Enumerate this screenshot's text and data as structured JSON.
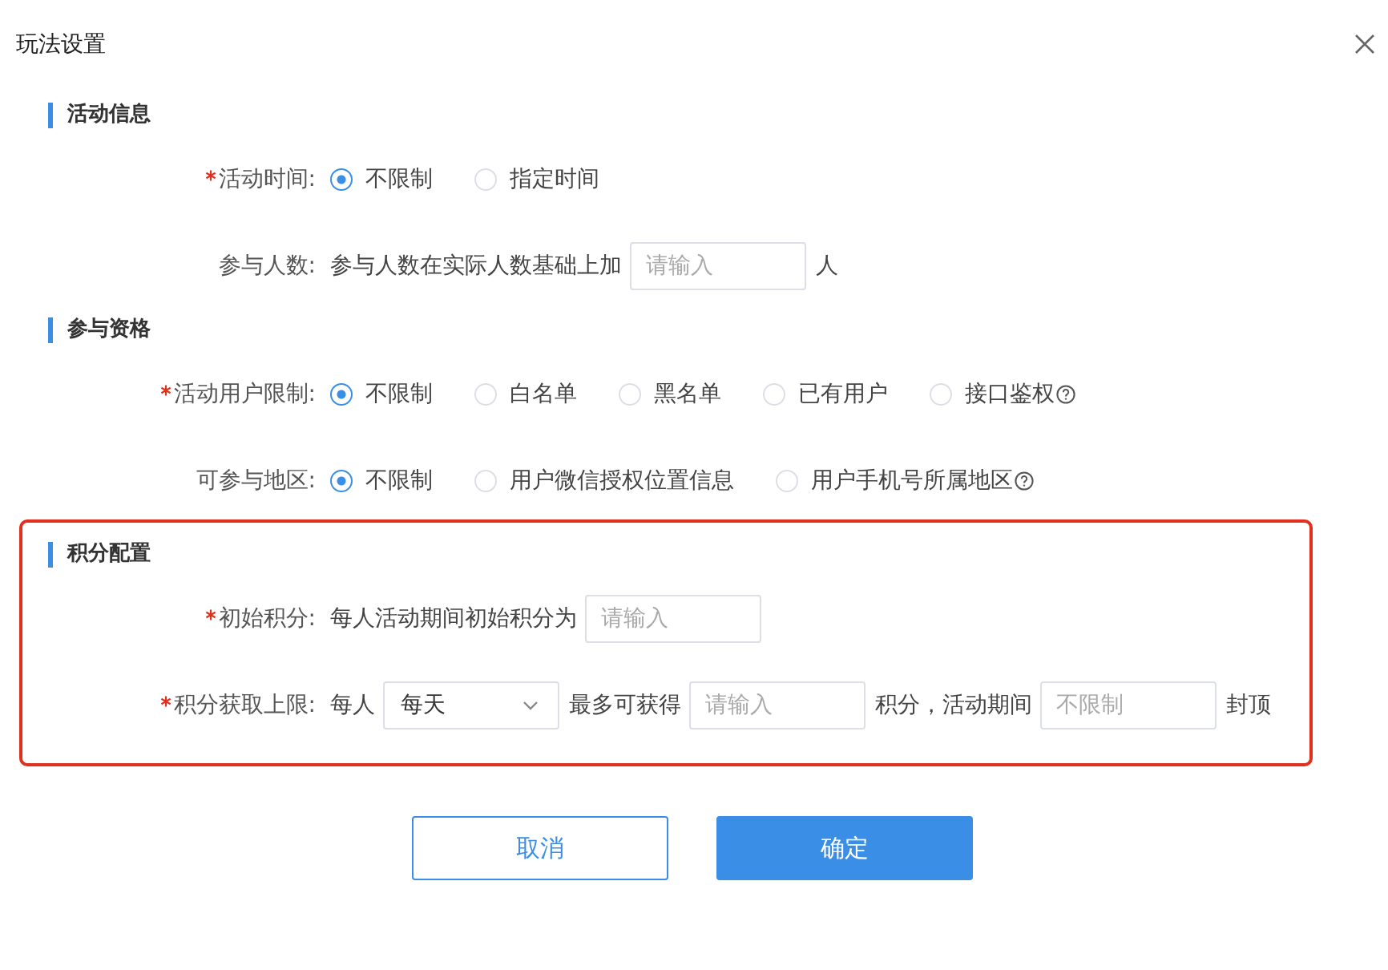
{
  "dialog": {
    "title": "玩法设置"
  },
  "sections": [
    {
      "title": "活动信息",
      "highlighted": false,
      "rows": [
        {
          "label": "活动时间:",
          "required": true,
          "items": [
            {
              "kind": "radio",
              "label": "不限制",
              "selected": true
            },
            {
              "kind": "radio",
              "label": "指定时间",
              "selected": false
            }
          ]
        },
        {
          "label": "参与人数:",
          "required": false,
          "items": [
            {
              "kind": "text",
              "text": "参与人数在实际人数基础上加"
            },
            {
              "kind": "input",
              "placeholder": "请输入"
            },
            {
              "kind": "text",
              "text": "人"
            }
          ]
        }
      ]
    },
    {
      "title": "参与资格",
      "highlighted": false,
      "rows": [
        {
          "label": "活动用户限制:",
          "required": true,
          "items": [
            {
              "kind": "radio",
              "label": "不限制",
              "selected": true
            },
            {
              "kind": "radio",
              "label": "白名单",
              "selected": false
            },
            {
              "kind": "radio",
              "label": "黑名单",
              "selected": false
            },
            {
              "kind": "radio",
              "label": "已有用户",
              "selected": false
            },
            {
              "kind": "radio",
              "label": "接口鉴权",
              "selected": false
            },
            {
              "kind": "help"
            }
          ]
        },
        {
          "label": "可参与地区:",
          "required": false,
          "items": [
            {
              "kind": "radio",
              "label": "不限制",
              "selected": true
            },
            {
              "kind": "radio",
              "label": "用户微信授权位置信息",
              "selected": false
            },
            {
              "kind": "radio",
              "label": "用户手机号所属地区",
              "selected": false
            },
            {
              "kind": "help"
            }
          ]
        }
      ]
    },
    {
      "title": "积分配置",
      "highlighted": true,
      "rows": [
        {
          "label": "初始积分:",
          "required": true,
          "items": [
            {
              "kind": "text",
              "text": "每人活动期间初始积分为"
            },
            {
              "kind": "input",
              "placeholder": "请输入"
            }
          ]
        },
        {
          "label": "积分获取上限:",
          "required": true,
          "items": [
            {
              "kind": "text",
              "text": "每人"
            },
            {
              "kind": "select",
              "value": "每天"
            },
            {
              "kind": "text",
              "text": "最多可获得"
            },
            {
              "kind": "input",
              "placeholder": "请输入"
            },
            {
              "kind": "text",
              "text": "积分，活动期间"
            },
            {
              "kind": "input",
              "placeholder": "不限制"
            },
            {
              "kind": "text",
              "text": "封顶"
            }
          ]
        }
      ]
    }
  ],
  "buttons": [
    {
      "label": "取消",
      "kind": "secondary"
    },
    {
      "label": "确定",
      "kind": "primary"
    }
  ]
}
